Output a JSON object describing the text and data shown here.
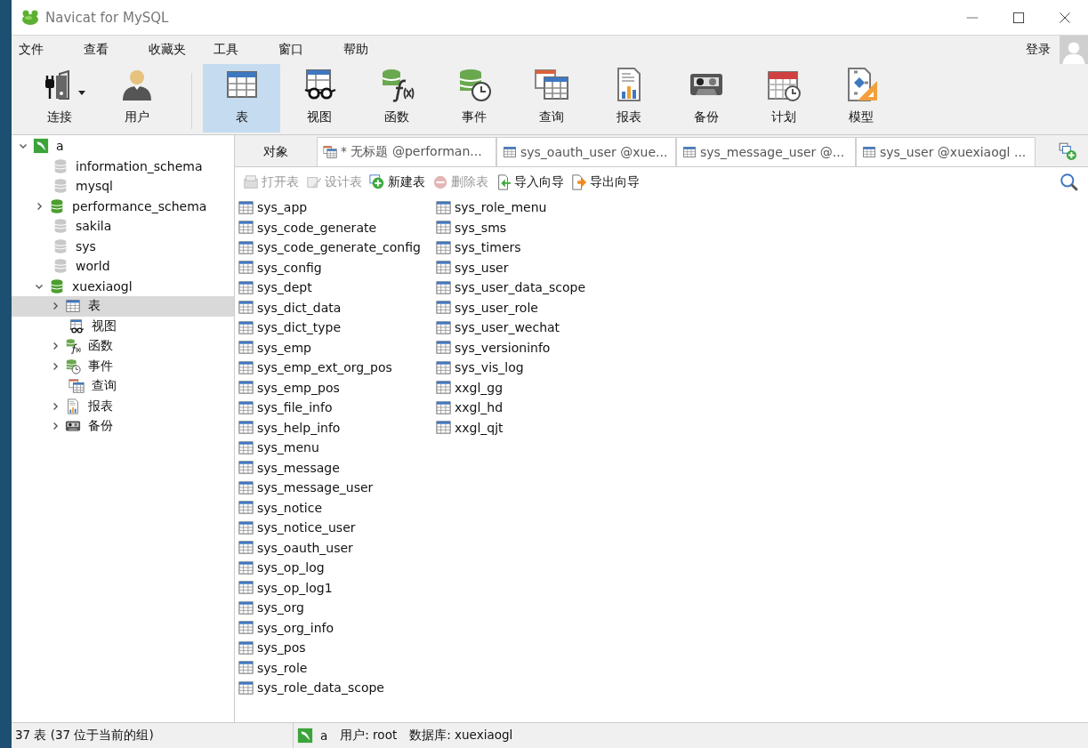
{
  "window": {
    "title": "Navicat for MySQL"
  },
  "menu": [
    "文件",
    "查看",
    "收藏夹",
    "工具",
    "窗口",
    "帮助"
  ],
  "account": {
    "login": "登录"
  },
  "toolbar": [
    {
      "kind": "connection",
      "label": "连接",
      "selected": false,
      "dropdown": true
    },
    {
      "kind": "user",
      "label": "用户",
      "selected": false,
      "dropdown": false
    },
    {
      "kind": "table",
      "label": "表",
      "selected": true,
      "dropdown": false
    },
    {
      "kind": "view",
      "label": "视图",
      "selected": false,
      "dropdown": false
    },
    {
      "kind": "function",
      "label": "函数",
      "selected": false,
      "dropdown": false
    },
    {
      "kind": "event",
      "label": "事件",
      "selected": false,
      "dropdown": false
    },
    {
      "kind": "query",
      "label": "查询",
      "selected": false,
      "dropdown": false
    },
    {
      "kind": "report",
      "label": "报表",
      "selected": false,
      "dropdown": false
    },
    {
      "kind": "backup",
      "label": "备份",
      "selected": false,
      "dropdown": false
    },
    {
      "kind": "schedule",
      "label": "计划",
      "selected": false,
      "dropdown": false
    },
    {
      "kind": "model",
      "label": "模型",
      "selected": false,
      "dropdown": false
    }
  ],
  "tree": [
    {
      "kind": "connection",
      "label": "a",
      "expanded": true,
      "selected": false,
      "children": [
        {
          "kind": "database",
          "label": "information_schema",
          "open": false,
          "selected": false
        },
        {
          "kind": "database",
          "label": "mysql",
          "open": false,
          "selected": false
        },
        {
          "kind": "database",
          "label": "performance_schema",
          "open": true,
          "expanded": false,
          "selected": false
        },
        {
          "kind": "database",
          "label": "sakila",
          "open": false,
          "selected": false
        },
        {
          "kind": "database",
          "label": "sys",
          "open": false,
          "selected": false
        },
        {
          "kind": "database",
          "label": "world",
          "open": false,
          "selected": false
        },
        {
          "kind": "database",
          "label": "xuexiaogl",
          "open": true,
          "expanded": true,
          "selected": false,
          "children": [
            {
              "kind": "table",
              "label": "表",
              "expanded": false,
              "selected": true
            },
            {
              "kind": "view",
              "label": "视图",
              "selected": false
            },
            {
              "kind": "function",
              "label": "函数",
              "expanded": false,
              "selected": false
            },
            {
              "kind": "event",
              "label": "事件",
              "expanded": false,
              "selected": false
            },
            {
              "kind": "query",
              "label": "查询",
              "selected": false
            },
            {
              "kind": "report",
              "label": "报表",
              "expanded": false,
              "selected": false
            },
            {
              "kind": "backup",
              "label": "备份",
              "expanded": false,
              "selected": false
            }
          ]
        }
      ]
    }
  ],
  "tabs": [
    {
      "kind": "objects",
      "label": "对象",
      "selected": true
    },
    {
      "kind": "query",
      "label": "* 无标题 @performan...",
      "selected": false
    },
    {
      "kind": "table",
      "label": "sys_oauth_user @xue...",
      "selected": false
    },
    {
      "kind": "table",
      "label": "sys_message_user @...",
      "selected": false
    },
    {
      "kind": "table",
      "label": "sys_user @xuexiaogl ...",
      "selected": false
    }
  ],
  "actions": [
    {
      "kind": "open",
      "label": "打开表",
      "disabled": true
    },
    {
      "kind": "design",
      "label": "设计表",
      "disabled": true
    },
    {
      "kind": "new",
      "label": "新建表",
      "disabled": false
    },
    {
      "kind": "delete",
      "label": "删除表",
      "disabled": true
    },
    {
      "kind": "import",
      "label": "导入向导",
      "disabled": false
    },
    {
      "kind": "export",
      "label": "导出向导",
      "disabled": false
    }
  ],
  "tables": [
    "sys_app",
    "sys_code_generate",
    "sys_code_generate_config",
    "sys_config",
    "sys_dept",
    "sys_dict_data",
    "sys_dict_type",
    "sys_emp",
    "sys_emp_ext_org_pos",
    "sys_emp_pos",
    "sys_file_info",
    "sys_help_info",
    "sys_menu",
    "sys_message",
    "sys_message_user",
    "sys_notice",
    "sys_notice_user",
    "sys_oauth_user",
    "sys_op_log",
    "sys_op_log1",
    "sys_org",
    "sys_org_info",
    "sys_pos",
    "sys_role",
    "sys_role_data_scope",
    "sys_role_menu",
    "sys_sms",
    "sys_timers",
    "sys_user",
    "sys_user_data_scope",
    "sys_user_role",
    "sys_user_wechat",
    "sys_versioninfo",
    "sys_vis_log",
    "xxgl_gg",
    "xxgl_hd",
    "xxgl_qjt"
  ],
  "status_bar": {
    "summary": "37 表 (37 位于当前的组)",
    "connection": "a",
    "user": "用户: root",
    "database": "数据库: xuexiaogl"
  }
}
